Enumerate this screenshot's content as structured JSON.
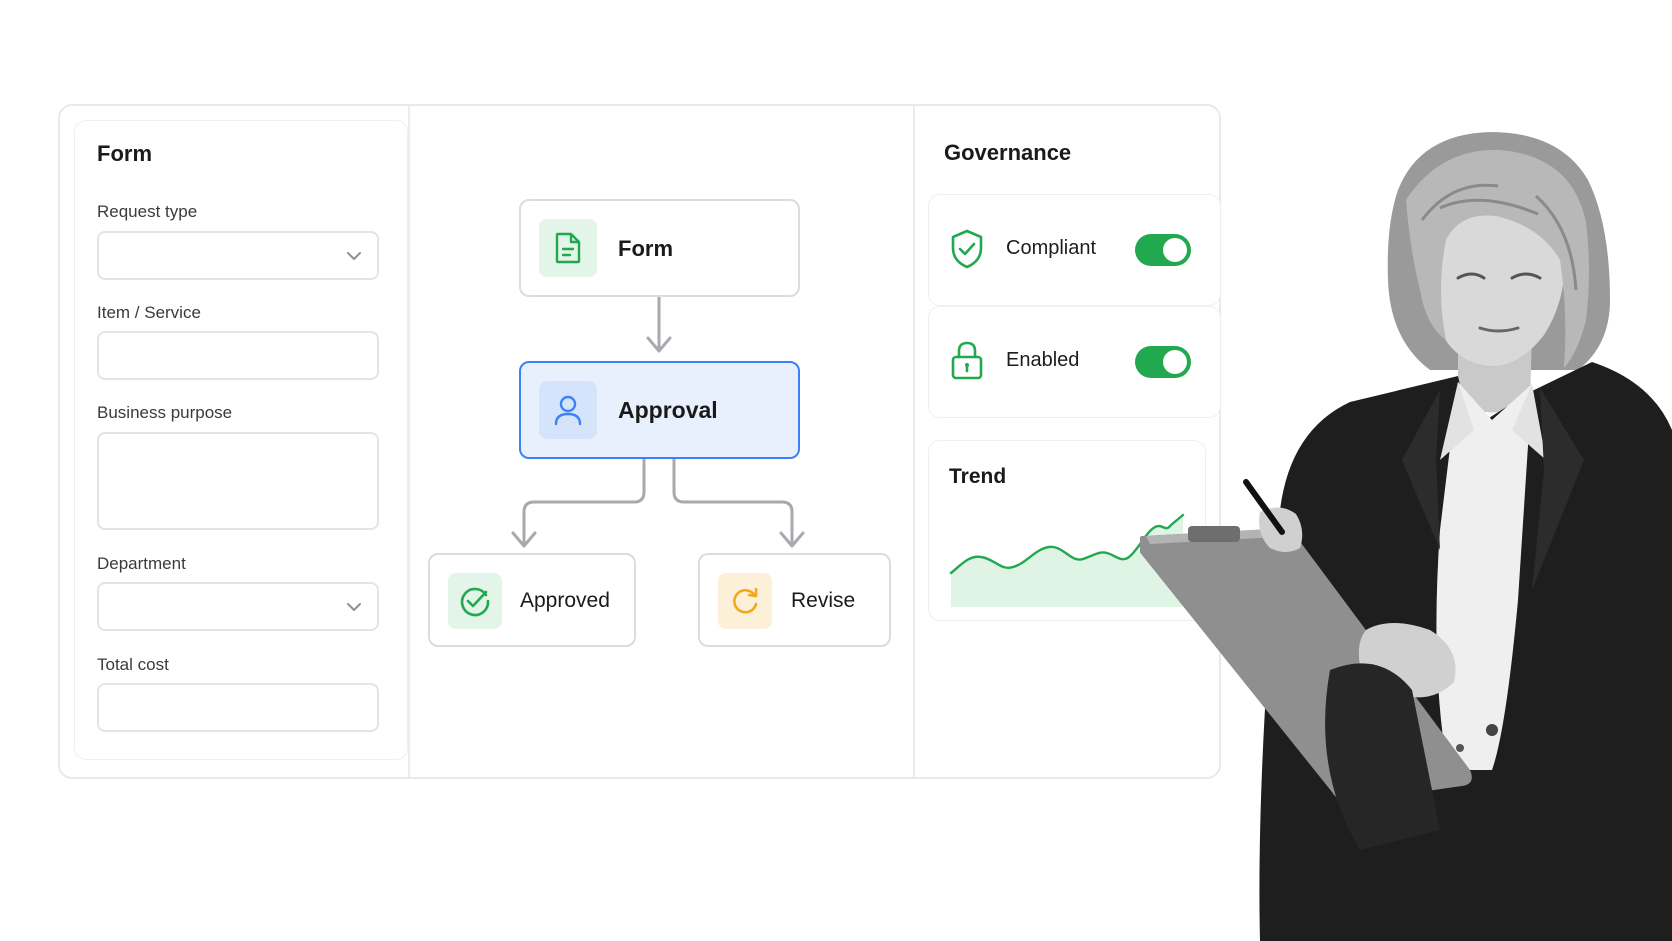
{
  "form": {
    "title": "Form",
    "fields": [
      {
        "label": "Request type",
        "type": "select",
        "value": ""
      },
      {
        "label": "Item / Service",
        "type": "text",
        "value": ""
      },
      {
        "label": "Business purpose",
        "type": "textarea",
        "value": ""
      },
      {
        "label": "Department",
        "type": "select",
        "value": ""
      },
      {
        "label": "Total cost",
        "type": "text",
        "value": ""
      }
    ]
  },
  "flow": {
    "nodes": [
      {
        "label": "Form",
        "icon": "document-icon",
        "accent": "#22a84f",
        "state": "default"
      },
      {
        "label": "Approval",
        "icon": "user-icon",
        "accent": "#3b82f6",
        "state": "selected"
      },
      {
        "label": "Approved",
        "icon": "check-circle-icon",
        "accent": "#22a84f",
        "state": "default"
      },
      {
        "label": "Revise",
        "icon": "refresh-icon",
        "accent": "#f0a81c",
        "state": "default"
      }
    ]
  },
  "governance": {
    "title": "Governance",
    "items": [
      {
        "label": "Compliant",
        "icon": "shield-check-icon",
        "enabled": true
      },
      {
        "label": "Enabled",
        "icon": "lock-icon",
        "enabled": true
      }
    ],
    "trend": {
      "title": "Trend"
    }
  },
  "colors": {
    "accent_green": "#22a84f",
    "accent_blue": "#3b82f6",
    "accent_orange": "#f0a81c",
    "selected_bg": "#e9f0fd"
  }
}
